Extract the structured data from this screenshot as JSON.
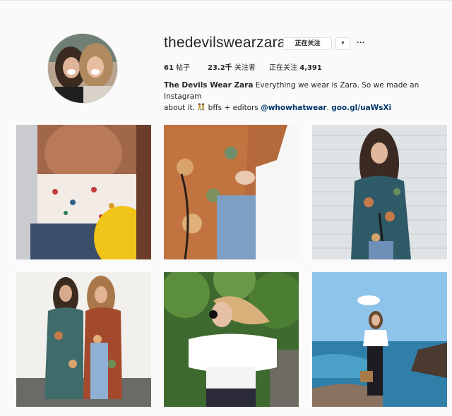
{
  "profile": {
    "username": "thedevilswearzara",
    "follow_label": "正在关注",
    "dropdown_glyph": "▼",
    "more_glyph": "···",
    "stats": {
      "posts_value": "61",
      "posts_label": "帖子",
      "followers_value": "23.2千",
      "followers_label": "关注者",
      "following_label": "正在关注",
      "following_value": "4,391"
    },
    "bio": {
      "name": "The Devils Wear Zara",
      "line1": " Everything we wear is Zara. So we made an Instagram",
      "line2_a": "about it. ",
      "line2_b": " bffs + editors ",
      "mention": "@whowhatwear",
      "sep": ". ",
      "link": "goo.gl/uaWsXi",
      "emoji_icon": "dancers-emoji"
    }
  },
  "grid": {
    "posts": [
      {
        "subject": "ruffle-crop-top-yellow-bag"
      },
      {
        "subject": "floral-wrap-kimono-jeans"
      },
      {
        "subject": "teal-floral-wrap-dress"
      },
      {
        "subject": "two-friends-kimono-robes"
      },
      {
        "subject": "white-off-shoulder-top"
      },
      {
        "subject": "white-top-striped-pants-sea"
      }
    ]
  },
  "colors": {
    "background": "#fafafa",
    "text": "#262626",
    "link": "#003569",
    "border": "#dbdbdb"
  }
}
